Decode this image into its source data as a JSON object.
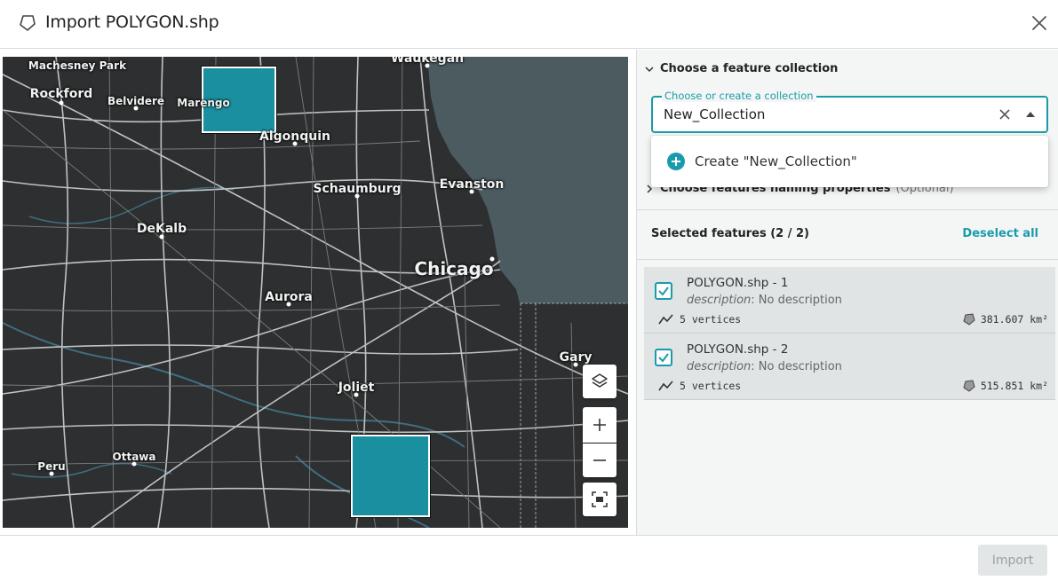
{
  "dialog": {
    "title": "Import POLYGON.shp",
    "icons": {
      "title": "polygon-icon",
      "close": "close-icon"
    }
  },
  "map": {
    "cities": [
      {
        "key": "machesney",
        "label": "Machesney Park"
      },
      {
        "key": "rockford",
        "label": "Rockford"
      },
      {
        "key": "belvidere",
        "label": "Belvidere"
      },
      {
        "key": "marengo",
        "label": "Marengo"
      },
      {
        "key": "waukegan",
        "label": "Waukegan"
      },
      {
        "key": "algonquin",
        "label": "Algonquin"
      },
      {
        "key": "schaumburg",
        "label": "Schaumburg"
      },
      {
        "key": "evanston",
        "label": "Evanston"
      },
      {
        "key": "dekalb",
        "label": "DeKalb"
      },
      {
        "key": "chicago",
        "label": "Chicago"
      },
      {
        "key": "aurora",
        "label": "Aurora"
      },
      {
        "key": "gary",
        "label": "Gary"
      },
      {
        "key": "joliet",
        "label": "Joliet"
      },
      {
        "key": "peru",
        "label": "Peru"
      },
      {
        "key": "ottawa",
        "label": "Ottawa"
      }
    ],
    "controls": {
      "layers": "layers-icon",
      "zoom_in": "plus-icon",
      "zoom_out": "minus-icon",
      "fit": "fit-bounds-icon"
    },
    "colors": {
      "background": "#2d2f30",
      "water": "#4b5b60",
      "polygon": "#1a8fa0"
    }
  },
  "panel": {
    "collection_section": "Choose a feature collection",
    "field": {
      "legend": "Choose or create a collection",
      "value": "New_Collection"
    },
    "dropdown_option": "Create \"New_Collection\"",
    "naming_section": "Choose features naming properties",
    "naming_optional": "(Optional)",
    "selected_label": "Selected features (2 / 2)",
    "deselect_all": "Deselect all",
    "features": [
      {
        "name": "POLYGON.shp - 1",
        "desc_key": "description",
        "desc_value": ": No description",
        "vertices": "5 vertices",
        "area": "381.607 km²",
        "checked": true
      },
      {
        "name": "POLYGON.shp - 2",
        "desc_key": "description",
        "desc_value": ": No description",
        "vertices": "5 vertices",
        "area": "515.851 km²",
        "checked": true
      }
    ]
  },
  "footer": {
    "import": "Import"
  },
  "accent": "#1a9bab"
}
